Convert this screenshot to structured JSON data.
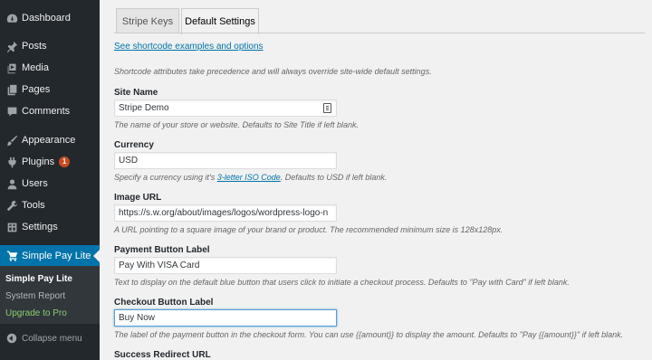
{
  "sidebar": {
    "items": [
      {
        "label": "Dashboard",
        "icon": "dashboard-icon"
      },
      {
        "label": "Posts",
        "icon": "pin-icon"
      },
      {
        "label": "Media",
        "icon": "media-icon"
      },
      {
        "label": "Pages",
        "icon": "pages-icon"
      },
      {
        "label": "Comments",
        "icon": "comment-icon"
      },
      {
        "label": "Appearance",
        "icon": "brush-icon"
      },
      {
        "label": "Plugins",
        "icon": "plugin-icon",
        "badge": "1"
      },
      {
        "label": "Users",
        "icon": "user-icon"
      },
      {
        "label": "Tools",
        "icon": "wrench-icon"
      },
      {
        "label": "Settings",
        "icon": "settings-icon"
      }
    ],
    "active": {
      "label": "Simple Pay Lite",
      "icon": "cart-icon"
    },
    "submenu": [
      "Simple Pay Lite",
      "System Report",
      "Upgrade to Pro"
    ],
    "collapse": {
      "label": "Collapse menu",
      "icon": "collapse-icon"
    }
  },
  "tabs": [
    "Stripe Keys",
    "Default Settings"
  ],
  "shortcode_link": "See shortcode examples and options",
  "intro_note": "Shortcode attributes take precedence and will always override site-wide default settings.",
  "fields": {
    "site_name": {
      "label": "Site Name",
      "value": "Stripe Demo",
      "help": "The name of your store or website. Defaults to Site Title if left blank."
    },
    "currency": {
      "label": "Currency",
      "value": "USD",
      "help_before": "Specify a currency using it's ",
      "help_link": "3-letter ISO Code",
      "help_after": ". Defaults to USD if left blank."
    },
    "image_url": {
      "label": "Image URL",
      "value": "https://s.w.org/about/images/logos/wordpress-logo-n",
      "help": "A URL pointing to a square image of your brand or product. The recommended minimum size is 128x128px."
    },
    "payment_button": {
      "label": "Payment Button Label",
      "value": "Pay With VISA Card",
      "help": "Text to display on the default blue button that users click to initiate a checkout process. Defaults to \"Pay with Card\" if left blank."
    },
    "checkout_button": {
      "label": "Checkout Button Label",
      "value": "Buy Now",
      "help": "The label of the payment button in the checkout form. You can use {{amount}} to display the amount. Defaults to \"Pay {{amount}}\" if left blank."
    },
    "success_redirect": {
      "label": "Success Redirect URL"
    }
  },
  "colors": {
    "sidebar_bg": "#23282d",
    "active_bg": "#0073aa",
    "badge_bg": "#ca4a1f",
    "upgrade": "#8acd6e",
    "link": "#0073aa"
  }
}
